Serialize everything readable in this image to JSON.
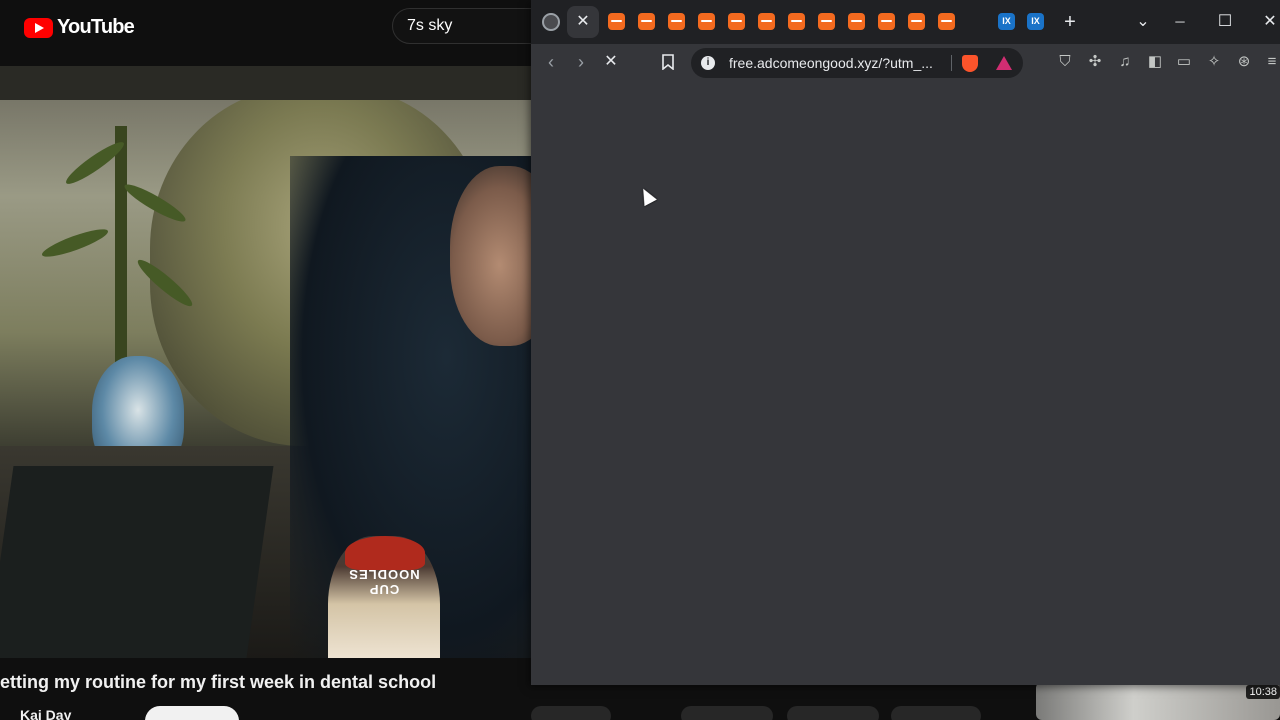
{
  "youtube": {
    "logo_text": "YouTube",
    "search_value": "7s sky",
    "video_title": "etting my routine for my first week in dental school",
    "channel_name": "Kai Day",
    "cup_text": "CUP NOODLES",
    "thumbnail_duration": "10:38"
  },
  "browser": {
    "active_tab_icon": "close-icon",
    "tabs": [
      {
        "icon": "globe-icon"
      },
      {
        "icon": "close-icon",
        "active": true
      },
      {
        "icon": "orange-site-icon"
      },
      {
        "icon": "orange-site-icon"
      },
      {
        "icon": "orange-site-icon"
      },
      {
        "icon": "orange-site-icon"
      },
      {
        "icon": "orange-site-icon"
      },
      {
        "icon": "orange-site-icon"
      },
      {
        "icon": "orange-site-icon"
      },
      {
        "icon": "orange-site-icon"
      },
      {
        "icon": "orange-site-icon"
      },
      {
        "icon": "orange-site-icon"
      },
      {
        "icon": "orange-site-icon"
      },
      {
        "icon": "blue-ix-icon",
        "label": "IX"
      },
      {
        "icon": "blue-ix-icon",
        "label": "IX"
      }
    ],
    "new_tab_label": "+",
    "window_controls": {
      "tab_search": "⌄",
      "minimize": "─",
      "maximize": "☐",
      "close": "✕"
    },
    "toolbar": {
      "back": "‹",
      "forward": "›",
      "stop": "✕",
      "bookmark_icon": "bookmark-icon",
      "info_icon_label": "i",
      "url": "free.adcomeongood.xyz/?utm_..."
    },
    "extensions": [
      "shield-icon",
      "puzzle-icon",
      "music-icon",
      "sidebar-icon",
      "wallet-icon",
      "ai-sparkle-icon",
      "vpn-icon",
      "menu-icon"
    ],
    "colors": {
      "tab_strip": "#202124",
      "window": "#35363a",
      "orange_tab": "#f36a1f",
      "blue_tab": "#1a73c8",
      "brave_lion": "#fb542b",
      "brave_rewards": "#d12d72"
    }
  }
}
